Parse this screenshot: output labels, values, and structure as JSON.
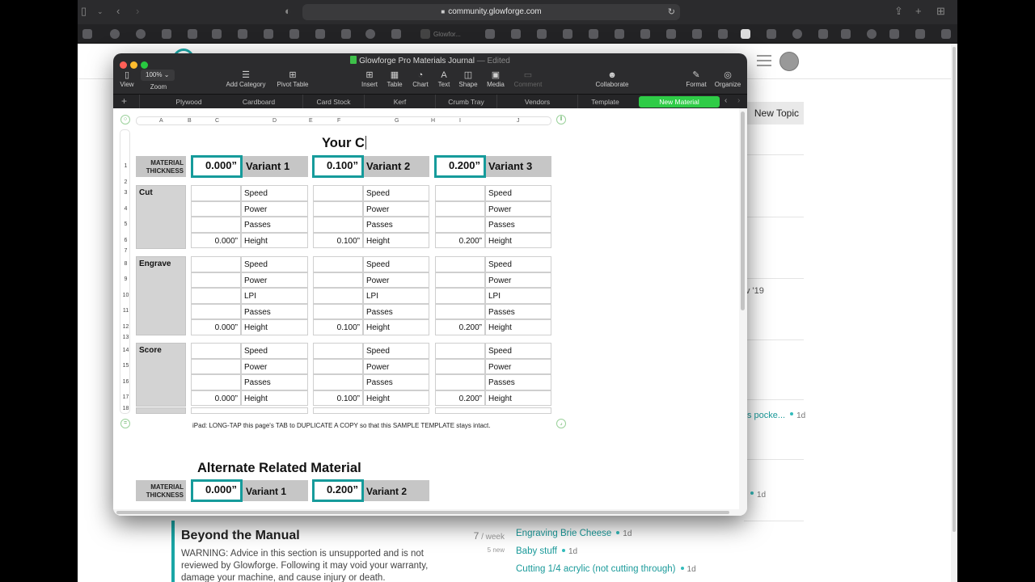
{
  "browser": {
    "url": "community.glowforge.com",
    "tab_label": "Glowfor..."
  },
  "community": {
    "new_topic_label": "New Topic",
    "fragments": {
      "date": "v '19",
      "link1": "s pocke...",
      "link1_age": "1d",
      "age2": "1d"
    },
    "category": {
      "title": "Beyond the Manual",
      "description": "WARNING: Advice in this section is unsupported and is not reviewed by Glowforge. Following it may void your warranty, damage your machine, and cause injury or death.",
      "stats_num": "7",
      "stats_unit": " / week",
      "stats_new": "5 new"
    },
    "topics": [
      {
        "title": "Engraving Brie Cheese",
        "age": "1d"
      },
      {
        "title": "Baby stuff",
        "age": "1d"
      },
      {
        "title": "Cutting 1/4 acrylic (not cutting through)",
        "age": "1d"
      }
    ]
  },
  "numbers": {
    "doc_title": "Glowforge Pro Materials Journal",
    "doc_status": "— Edited",
    "zoom": "100%",
    "toolbar": {
      "view": "View",
      "zoom": "Zoom",
      "add_category": "Add Category",
      "pivot_table": "Pivot Table",
      "insert": "Insert",
      "table": "Table",
      "chart": "Chart",
      "text": "Text",
      "shape": "Shape",
      "media": "Media",
      "comment": "Comment",
      "collaborate": "Collaborate",
      "format": "Format",
      "organize": "Organize"
    },
    "sheets": [
      "Plywood",
      "Cardboard",
      "Card Stock",
      "Kerf",
      "Crumb Tray",
      "Vendors",
      "Template",
      "New Material"
    ],
    "columns": [
      "A",
      "B",
      "C",
      "D",
      "E",
      "F",
      "G",
      "H",
      "I",
      "J"
    ],
    "rows": [
      "1",
      "2",
      "3",
      "4",
      "5",
      "6",
      "7",
      "8",
      "9",
      "10",
      "11",
      "12",
      "13",
      "14",
      "15",
      "16",
      "17",
      "18"
    ],
    "title_partial": "Your C",
    "material_label_1": "MATERIAL",
    "material_label_2": "THICKNESS",
    "variants": [
      {
        "thickness": "0.000”",
        "name": "Variant 1"
      },
      {
        "thickness": "0.100”",
        "name": "Variant 2"
      },
      {
        "thickness": "0.200”",
        "name": "Variant 3"
      }
    ],
    "sections": {
      "cut": "Cut",
      "engrave": "Engrave",
      "score": "Score"
    },
    "params": {
      "speed": "Speed",
      "power": "Power",
      "passes": "Passes",
      "height": "Height",
      "lpi": "LPI"
    },
    "footnote": "iPad: LONG-TAP this page's TAB to DUPLICATE A COPY so that this SAMPLE TEMPLATE stays intact.",
    "alt_title": "Alternate Related Material",
    "alt_variants": [
      {
        "thickness": "0.000”",
        "name": "Variant 1"
      },
      {
        "thickness": "0.200”",
        "name": "Variant 2"
      }
    ]
  }
}
